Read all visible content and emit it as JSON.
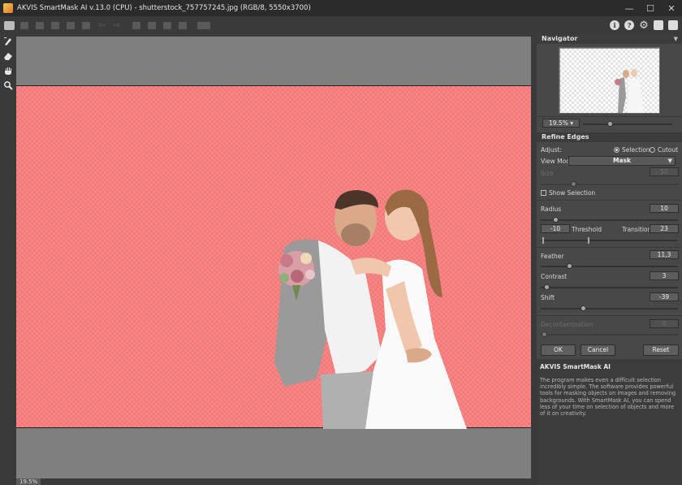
{
  "window": {
    "title": "AKVIS SmartMask AI v.13.0 (CPU) - shutterstock_757757245.jpg (RGB/8, 5550x3700)",
    "minimize": "—",
    "maximize": "☐",
    "close": "✕"
  },
  "toolbar": {
    "prev_arrow": "⇦",
    "next_arrow": "⇨",
    "info_label": "i",
    "help_label": "?",
    "settings_glyph": "⚙"
  },
  "status": {
    "zoom": "19.5%"
  },
  "navigator": {
    "title": "Navigator",
    "zoom": "19.5%",
    "zoom_slider_fraction": 0.3
  },
  "refine": {
    "title": "Refine Edges",
    "adjust_label": "Adjust:",
    "selection_label": "Selection",
    "cutout_label": "Cutout",
    "view_mode_label": "View Mode:",
    "view_mode_value": "Mask",
    "size_label": "Size",
    "size_value": "50",
    "show_selection_label": "Show Selection",
    "radius_label": "Radius",
    "radius_value": "10",
    "threshold_value": "-10",
    "threshold_label": "Threshold",
    "transition_label": "Transition",
    "transition_value": "23",
    "feather_label": "Feather",
    "feather_value": "11,3",
    "contrast_label": "Contrast",
    "contrast_value": "3",
    "shift_label": "Shift",
    "shift_value": "-39",
    "decontaminate_label": "Decontamination",
    "decontaminate_value": "0"
  },
  "buttons": {
    "ok": "OK",
    "cancel": "Cancel",
    "reset": "Reset"
  },
  "description": {
    "title": "AKVIS SmartMask AI",
    "text": "The program makes even a difficult selection incredibly simple. The software provides powerful tools for masking objects on images and removing backgrounds. With SmartMask AI, you can spend less of your time on selection of objects and more of it on creativity."
  },
  "colors": {
    "mask_overlay": "#f47a79",
    "panel_bg": "#484848",
    "canvas_bg": "#7f7f7f"
  }
}
